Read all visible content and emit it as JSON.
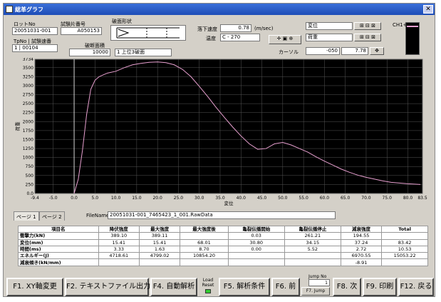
{
  "window": {
    "title": "総革グラフ"
  },
  "top": {
    "lot_label": "ロットNo",
    "lot_value": "20051031-001",
    "piece_label": "試験片番号",
    "piece_value": "A050153",
    "tp_label": "TpNo | 試験速番",
    "tp_value": "1 | 00104",
    "shape_label": "破面形状",
    "area_label": "破断面積",
    "area_value": "10000",
    "shape_value": "1 上位3破面",
    "speed_label": "落下速度",
    "speed_value": "0.78",
    "speed_unit": "(m/sec)",
    "temp_label": "温度",
    "temp_value": "C - 270",
    "y_select": "変位",
    "x_select": "荷重",
    "cursor_label": "カーソル",
    "cursor_x": "-050",
    "cursor_y": "7.78",
    "ch_label": "CH1+2"
  },
  "chart_data": {
    "type": "line",
    "xlabel": "変位",
    "ylabel": "荷重",
    "xlim": [
      -9.4,
      83.5
    ],
    "ylim": [
      0,
      3734
    ],
    "x_ticks": [
      "-9.4",
      "-5.0",
      "0.0",
      "5.0",
      "10.0",
      "15.0",
      "20.0",
      "25.0",
      "30.0",
      "35.0",
      "40.0",
      "45.0",
      "50.0",
      "55.0",
      "60.0",
      "65.0",
      "70.0",
      "75.0",
      "80.0",
      "83.5"
    ],
    "x_tick_values": [
      -9.4,
      -5,
      0,
      5,
      10,
      15,
      20,
      25,
      30,
      35,
      40,
      45,
      50,
      55,
      60,
      65,
      70,
      75,
      80,
      83.5
    ],
    "y_ticks": [
      "3734",
      "3500",
      "3250",
      "3000",
      "2750",
      "2500",
      "2250",
      "2000",
      "1750",
      "1500",
      "1250",
      "1000",
      "750",
      "500",
      "250",
      "0.0"
    ],
    "y_tick_values": [
      3734,
      3500,
      3250,
      3000,
      2750,
      2500,
      2250,
      2000,
      1750,
      1500,
      1250,
      1000,
      750,
      500,
      250,
      0
    ],
    "series": [
      {
        "color": "#e8a0d0",
        "x": [
          0,
          1,
          2,
          3,
          4,
          5,
          6,
          7,
          8,
          10,
          12,
          14,
          16,
          18,
          20,
          22,
          24,
          26,
          28,
          30,
          32,
          34,
          36,
          38,
          40,
          42,
          44,
          46,
          48,
          50,
          52,
          54,
          56,
          58,
          60,
          62,
          64,
          66,
          68,
          70,
          72,
          74,
          76,
          78,
          80,
          83
        ],
        "y": [
          0,
          400,
          1200,
          2200,
          2900,
          3150,
          3250,
          3300,
          3350,
          3400,
          3500,
          3580,
          3620,
          3650,
          3660,
          3640,
          3580,
          3450,
          3250,
          2980,
          2700,
          2400,
          2120,
          1850,
          1600,
          1380,
          1230,
          1250,
          1380,
          1420,
          1350,
          1250,
          1150,
          1020,
          900,
          790,
          680,
          590,
          510,
          450,
          400,
          350,
          310,
          290,
          270,
          250
        ]
      }
    ],
    "cursor_x": 0,
    "grid": true
  },
  "tabs": [
    "ページ 1",
    "ページ 2"
  ],
  "filename_label": "FileName",
  "filename_value": "20051031-001_7465423_1_001.RawData",
  "results": {
    "headers": [
      "項目名",
      "降伏強度",
      "最大強度",
      "最大強度後",
      "亀裂伝播開始",
      "亀裂伝播停止",
      "減衰強度",
      "Total"
    ],
    "rows": [
      [
        "衝撃力(kN)",
        "389.10",
        "389.11",
        "",
        "0.03",
        "261.21",
        "194.55",
        ""
      ],
      [
        "変位(mm)",
        "15.41",
        "15.41",
        "68.01",
        "30.80",
        "34.15",
        "37.24",
        "83.42"
      ],
      [
        "時間(ms)",
        "3.33",
        "1.63",
        "8.70",
        "0.00",
        "5.52",
        "2.72",
        "10.53"
      ],
      [
        "エネルギー(J)",
        "4718.61",
        "4799.02",
        "10854.20",
        "",
        "",
        "6970.55",
        "15053.22"
      ],
      [
        "減衰傾き(kN/mm)",
        "",
        "",
        "",
        "",
        "",
        "-8.91",
        ""
      ]
    ]
  },
  "buttons": {
    "f1": "F1. XY軸変更",
    "f2": "F2. テキストファイル出力",
    "f4": "F4. 自動解析",
    "load_reset": "Load Reset",
    "f5": "F5. 解析条件",
    "f6": "F6. 前",
    "jump_label": "Jump No",
    "jump_value": "1",
    "f7": "F7. Jump",
    "f8": "F8. 次",
    "f9": "F9. 印刷",
    "f12": "F12. 戻る"
  }
}
